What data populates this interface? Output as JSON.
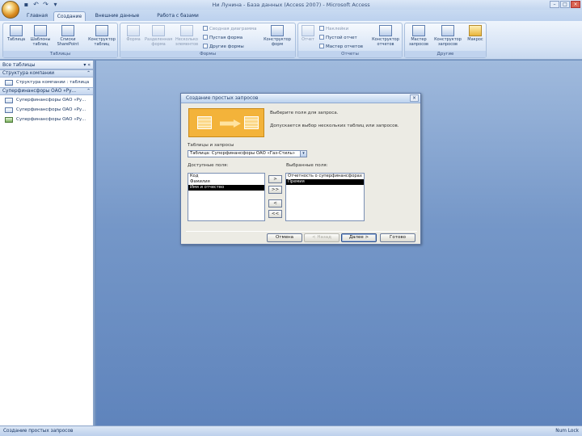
{
  "window": {
    "title": "Ни Лунина - База данных (Access 2007) - Microsoft Access",
    "controls": [
      "–",
      "□",
      "×"
    ]
  },
  "quick_access": [
    "save-icon",
    "undo-icon",
    "redo-icon",
    "dropdown-icon"
  ],
  "ribbon_tabs": [
    "Главная",
    "Создание",
    "Внешние данные",
    "Работа с базами данных"
  ],
  "active_tab": "Создание",
  "ribbon": {
    "tables": {
      "caption": "Таблицы",
      "buttons": [
        "Таблица",
        "Шаблоны таблиц",
        "Списки SharePoint",
        "Конструктор таблиц"
      ]
    },
    "forms": {
      "caption": "Формы",
      "buttons": [
        "Форма",
        "Разделенная форма",
        "Несколько элементов"
      ],
      "small": [
        "Сводная диаграмма",
        "Пустая форма",
        "Другие формы"
      ],
      "designer": "Конструктор форм"
    },
    "reports": {
      "caption": "Отчеты",
      "buttons": [
        "Отчет"
      ],
      "small": [
        "Наклейки",
        "Пустой отчет",
        "Мастер отчетов"
      ],
      "designer": "Конструктор отчетов"
    },
    "other": {
      "caption": "Другие",
      "buttons": [
        "Мастер запросов",
        "Конструктор запросов",
        "Макрос"
      ]
    }
  },
  "nav_pane": {
    "header": "Все таблицы",
    "groups": [
      {
        "title": "Структура компании",
        "items": [
          {
            "label": "Структура компании : таблица",
            "type": "table"
          }
        ]
      },
      {
        "title": "Суперфинансфоры ОАО «Ру...",
        "items": [
          {
            "label": "Суперфинансфоры ОАО «Ру...",
            "type": "table"
          },
          {
            "label": "Суперфинансфоры ОАО «Ру...",
            "type": "table"
          },
          {
            "label": "Суперфинансфоры ОАО «Ру...",
            "type": "query"
          }
        ]
      }
    ]
  },
  "dialog": {
    "title": "Создание простых запросов",
    "prompt": "Выберите поля для запроса.",
    "hint": "Допускается выбор нескольких таблиц или запросов.",
    "tables_label": "Таблицы и запросы",
    "tables_value": "Таблица: Суперфинансфоры ОАО «Газ-Стиль»",
    "available_label": "Доступные поля:",
    "available_fields": [
      "Код",
      "Фамилия",
      "Имя и отчество"
    ],
    "available_selected": 2,
    "selected_label": "Выбранные поля:",
    "selected_fields": [
      "Отчетность о суперфинансфорах",
      "Премия"
    ],
    "selected_selected": 1,
    "move_buttons": [
      ">",
      ">>",
      "<",
      "<<"
    ],
    "buttons": {
      "cancel": "Отмена",
      "back": "< Назад",
      "next": "Далее >",
      "finish": "Готово"
    }
  },
  "status": {
    "left": "Создание простых запросов",
    "right": "Num Lock"
  }
}
